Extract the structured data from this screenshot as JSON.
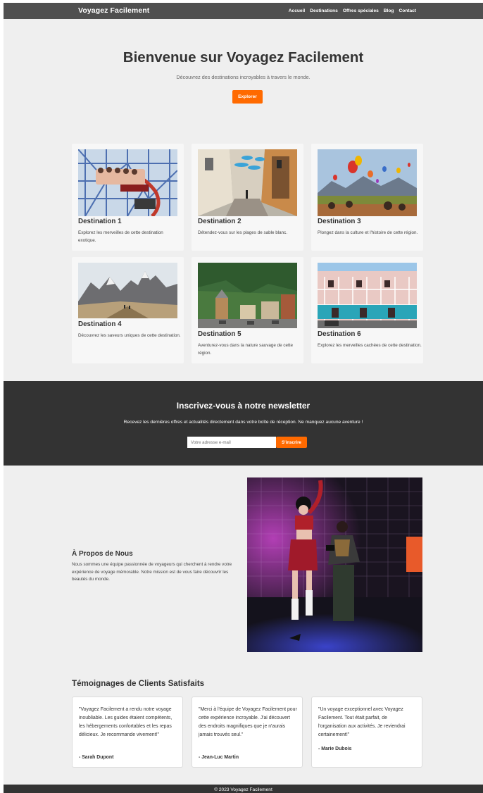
{
  "header": {
    "brand": "Voyagez Facilement",
    "nav": [
      "Accueil",
      "Destinations",
      "Offres spéciales",
      "Blog",
      "Contact"
    ]
  },
  "hero": {
    "title": "Bienvenue sur Voyagez Facilement",
    "subtitle": "Découvrez des destinations incroyables à travers le monde.",
    "button": "Explorer"
  },
  "destinations": [
    {
      "title": "Destination 1",
      "description": "Explorez les merveilles de cette destination exotique."
    },
    {
      "title": "Destination 2",
      "description": "Détendez-vous sur les plages de sable blanc."
    },
    {
      "title": "Destination 3",
      "description": "Plongez dans la culture et l'histoire de cette région."
    },
    {
      "title": "Destination 4",
      "description": "Découvrez les saveurs uniques de cette destination."
    },
    {
      "title": "Destination 5",
      "description": "Aventurez-vous dans la nature sauvage de cette région."
    },
    {
      "title": "Destination 6",
      "description": "Explorez les merveilles cachées de cette destination."
    }
  ],
  "newsletter": {
    "title": "Inscrivez-vous à notre newsletter",
    "text": "Recevez les dernières offres et actualités directement dans votre boîte de réception. Ne manquez aucune aventure !",
    "placeholder": "Votre adresse e-mail",
    "button": "S'inscrire"
  },
  "about": {
    "title": "À Propos de Nous",
    "text": "Nous sommes une équipe passionnée de voyageurs qui cherchent à rendre votre expérience de voyage mémorable. Notre mission est de vous faire découvrir les beautés du monde."
  },
  "testimonials": {
    "title": "Témoignages de Clients Satisfaits",
    "items": [
      {
        "quote": "\"Voyagez Facilement a rendu notre voyage inoubliable. Les guides étaient compétents, les hébergements confortables et les repas délicieux. Je recommande vivement!\"",
        "author": "- Sarah Dupont"
      },
      {
        "quote": "\"Merci à l'équipe de Voyagez Facilement pour cette expérience incroyable. J'ai découvert des endroits magnifiques que je n'aurais jamais trouvés seul.\"",
        "author": "- Jean-Luc Martin"
      },
      {
        "quote": "\"Un voyage exceptionnel avec Voyagez Facilement. Tout était parfait, de l'organisation aux activités. Je reviendrai certainement!\"",
        "author": "- Marie Dubois"
      }
    ]
  },
  "footer": {
    "text": "© 2023 Voyagez Facilement"
  },
  "colors": {
    "accent": "#ff6a00",
    "header_bg": "#505050",
    "newsletter_bg": "#333333",
    "page_bg": "#efefef"
  }
}
